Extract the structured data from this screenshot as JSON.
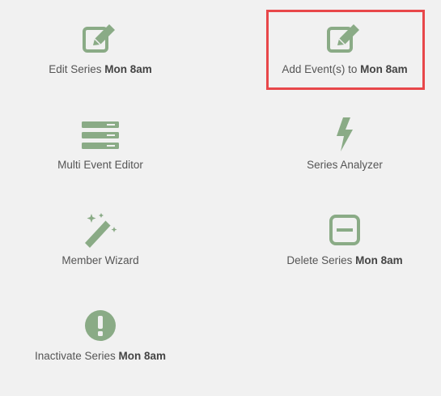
{
  "colors": {
    "icon": "#8aab86",
    "highlight": "#e8474a",
    "background": "#f1f1f1"
  },
  "tiles": [
    {
      "icon": "edit-icon",
      "text": "Edit Series",
      "bold": "Mon 8am"
    },
    {
      "icon": "edit-icon",
      "text": "Add Event(s) to",
      "bold": "Mon 8am"
    },
    {
      "icon": "list-icon",
      "text": "Multi Event Editor",
      "bold": ""
    },
    {
      "icon": "bolt-icon",
      "text": "Series Analyzer",
      "bold": ""
    },
    {
      "icon": "magic-wand-icon",
      "text": "Member Wizard",
      "bold": ""
    },
    {
      "icon": "minus-square-icon",
      "text": "Delete Series",
      "bold": "Mon 8am"
    },
    {
      "icon": "exclamation-circle-icon",
      "text": "Inactivate Series",
      "bold": "Mon 8am"
    }
  ]
}
